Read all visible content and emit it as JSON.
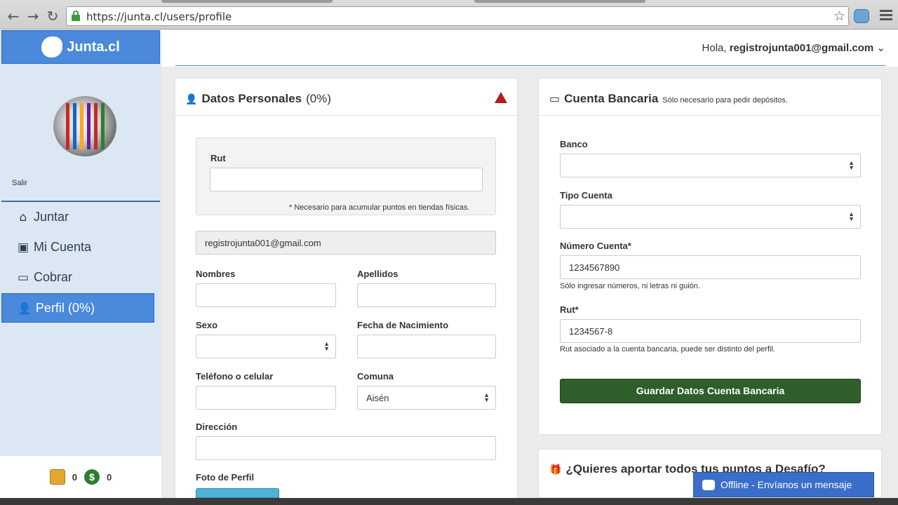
{
  "browser": {
    "back_icon": "arrow-left-icon",
    "forward_icon": "arrow-right-icon",
    "reload_icon": "reload-icon",
    "url": "https://junta.cl/users/profile"
  },
  "sidebar": {
    "brand": "Junta.cl",
    "salir": "Salir",
    "items": [
      {
        "label": "Juntar",
        "icon": "home-icon"
      },
      {
        "label": "Mi Cuenta",
        "icon": "money-icon"
      },
      {
        "label": "Cobrar",
        "icon": "credit-card-icon"
      }
    ],
    "active": {
      "label": "Perfil (0%)",
      "icon": "user-icon"
    },
    "footer": {
      "points": "0",
      "money": "0",
      "money_symbol": "$"
    }
  },
  "header": {
    "greeting": "Hola,",
    "email": "registrojunta001@gmail.com",
    "caret": "⌄"
  },
  "personal": {
    "title": "Datos Personales",
    "percent": "(0%)",
    "rut_label": "Rut",
    "rut_value": "",
    "rut_help": "* Necesario para acumular puntos en tiendas físicas.",
    "email_value": "registrojunta001@gmail.com",
    "nombres_label": "Nombres",
    "apellidos_label": "Apellidos",
    "sexo_label": "Sexo",
    "fecha_label": "Fecha de Nacimiento",
    "telefono_label": "Teléfono o celular",
    "comuna_label": "Comuna",
    "comuna_value": "Aisén",
    "direccion_label": "Dirección",
    "foto_label": "Foto de Perfil"
  },
  "bank": {
    "title": "Cuenta Bancaria",
    "subtitle": "Sólo necesario para pedir depósitos.",
    "banco_label": "Banco",
    "tipo_label": "Tipo Cuenta",
    "numero_label": "Número Cuenta*",
    "numero_value": "1234567890",
    "numero_help": "Sólo ingresar números, ni letras ni guión.",
    "rut_label": "Rut*",
    "rut_value": "1234567-8",
    "rut_help": "Rut asociado a la cuenta bancaria, puede ser distinto del perfil.",
    "save_button": "Guardar Datos Cuenta Bancaria"
  },
  "desafio": {
    "title": "¿Quieres aportar todos tus puntos a Desafío?"
  },
  "chat": {
    "label": "Offline - Envíanos un mensaje"
  },
  "colors": {
    "brand_blue": "#4a89dc",
    "save_green": "#2e5e2a",
    "warning_red": "#b71c1c"
  }
}
